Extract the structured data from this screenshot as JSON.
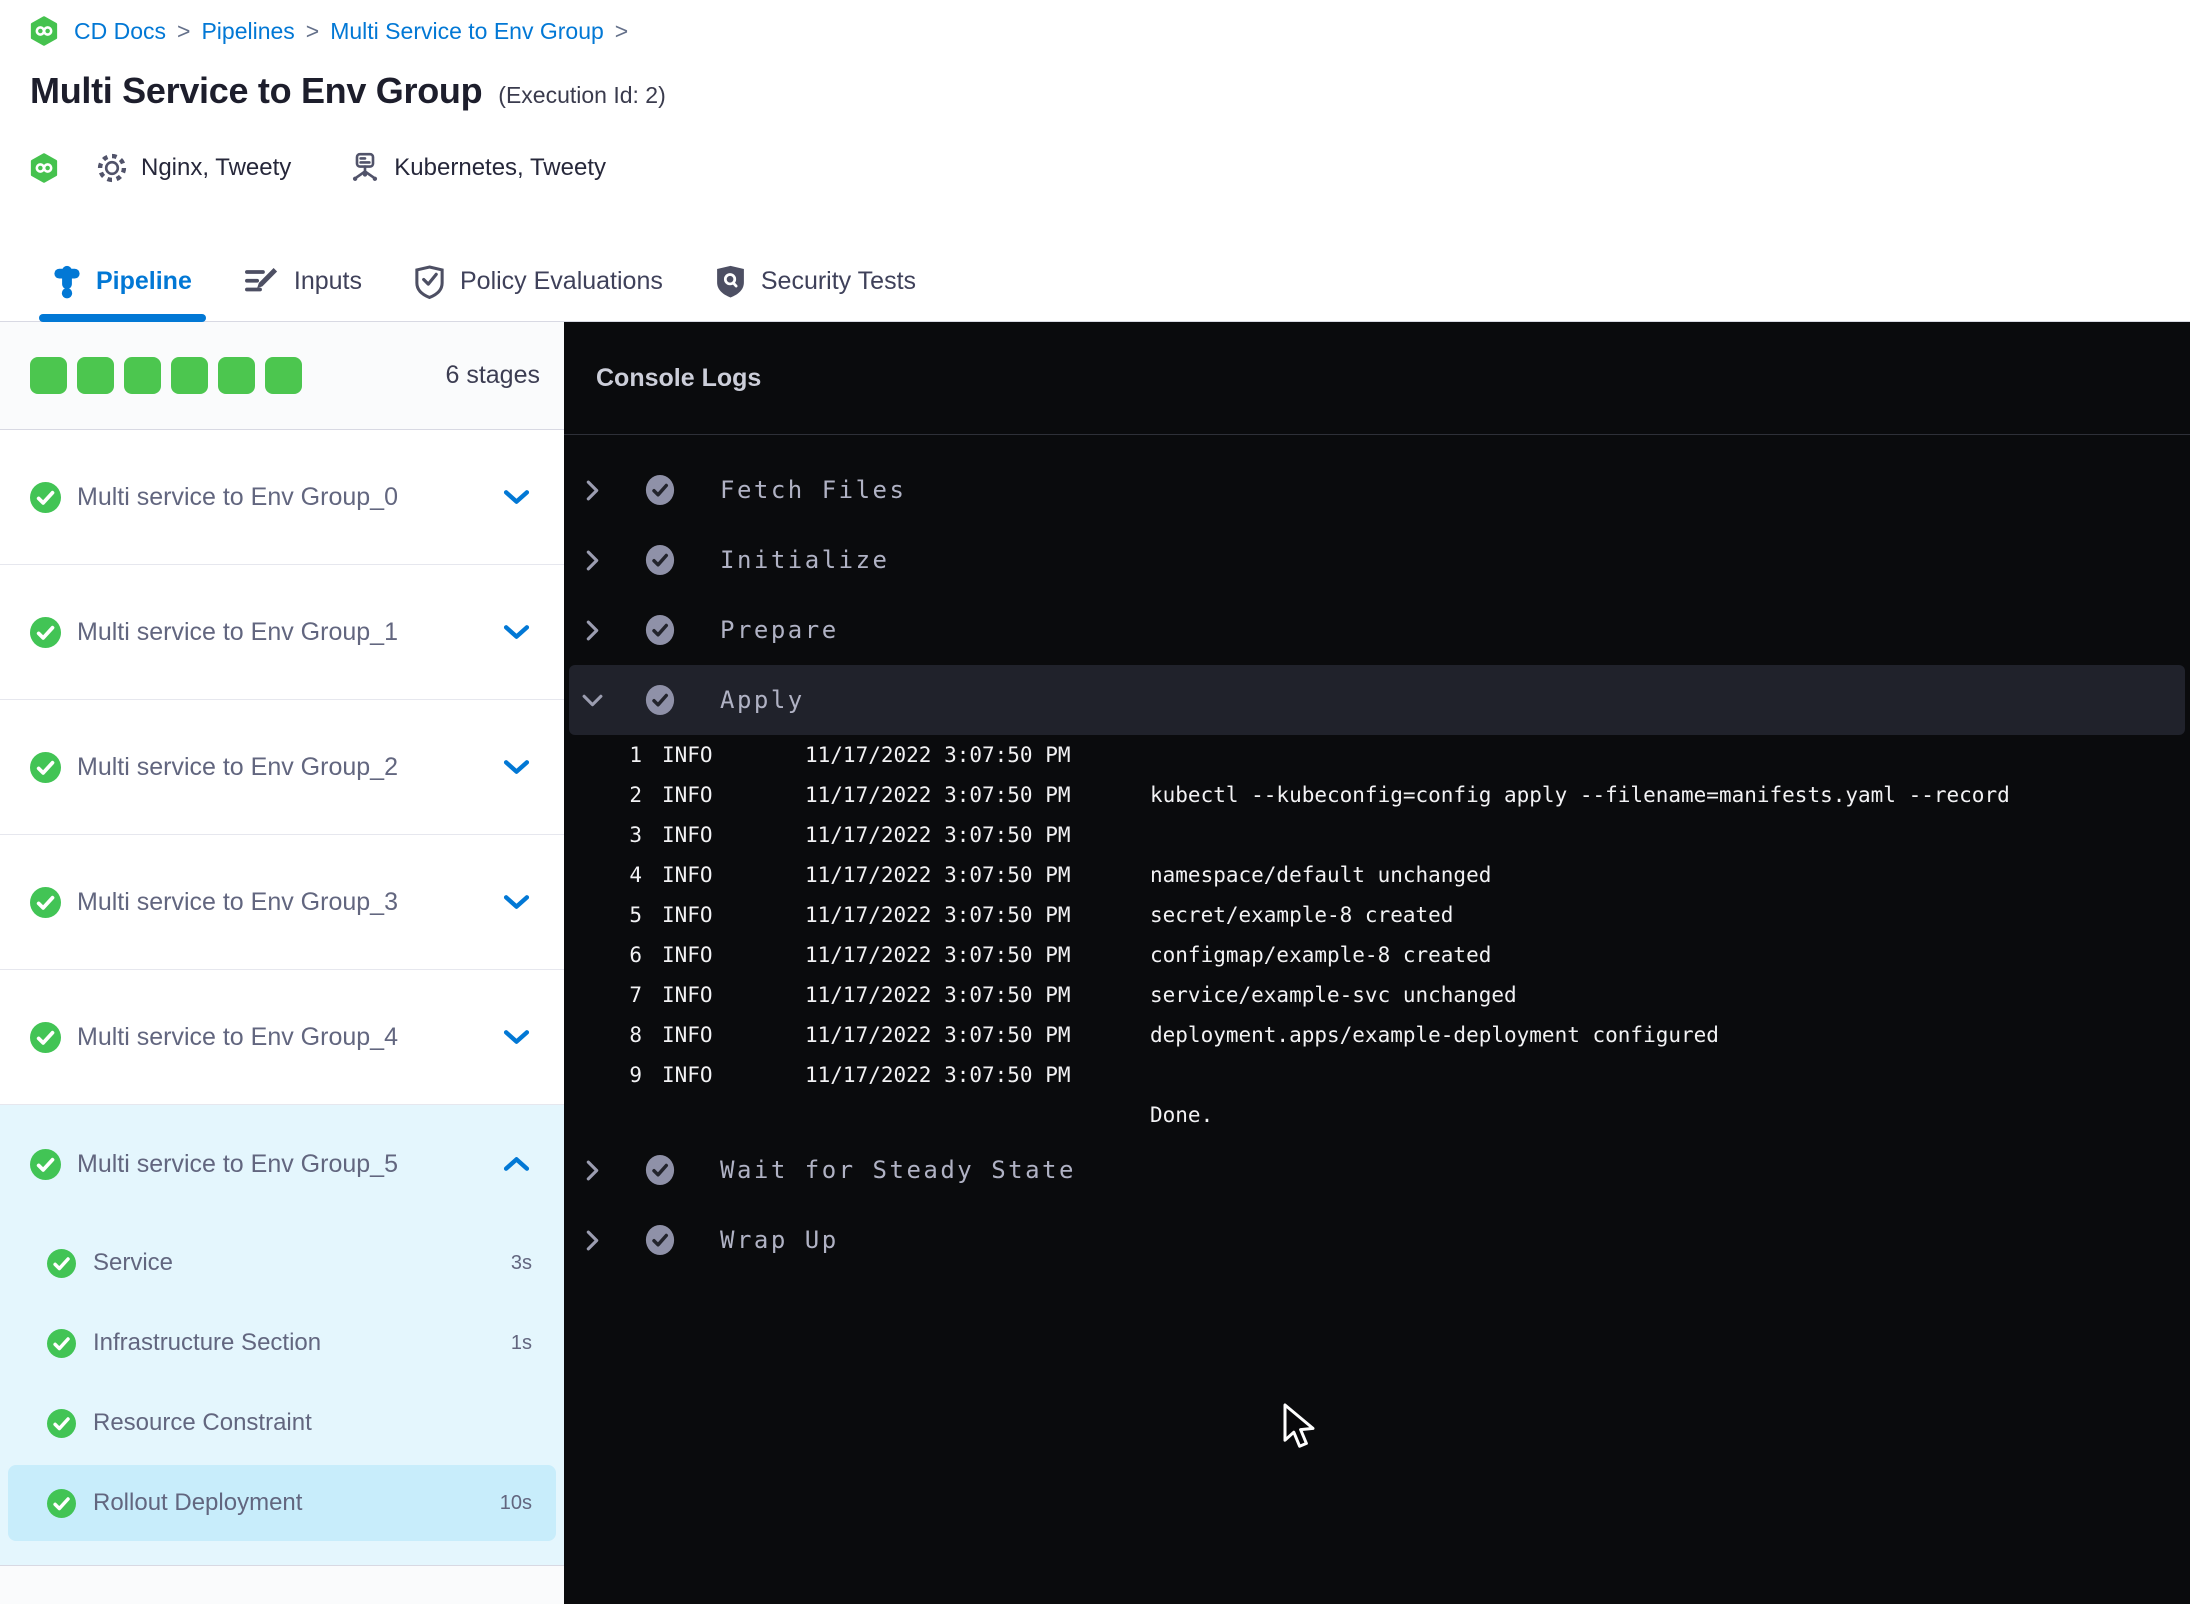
{
  "breadcrumb": {
    "links": [
      "CD Docs",
      "Pipelines",
      "Multi Service to Env Group"
    ],
    "separator": ">"
  },
  "header": {
    "title": "Multi Service to Env Group",
    "execution_id": "(Execution Id: 2)",
    "services_label": "Nginx, Tweety",
    "environments_label": "Kubernetes, Tweety"
  },
  "tabs": [
    {
      "label": "Pipeline",
      "icon": "pipeline-icon",
      "active": true
    },
    {
      "label": "Inputs",
      "icon": "inputs-icon",
      "active": false
    },
    {
      "label": "Policy Evaluations",
      "icon": "policy-shield-icon",
      "active": false
    },
    {
      "label": "Security Tests",
      "icon": "security-shield-icon",
      "active": false
    }
  ],
  "sidebar": {
    "stage_count_label": "6 stages",
    "progress_squares": 6,
    "stages": [
      {
        "label": "Multi service to Env Group_0",
        "status": "success",
        "expanded": false
      },
      {
        "label": "Multi service to Env Group_1",
        "status": "success",
        "expanded": false
      },
      {
        "label": "Multi service to Env Group_2",
        "status": "success",
        "expanded": false
      },
      {
        "label": "Multi service to Env Group_3",
        "status": "success",
        "expanded": false
      },
      {
        "label": "Multi service to Env Group_4",
        "status": "success",
        "expanded": false
      },
      {
        "label": "Multi service to Env Group_5",
        "status": "success",
        "expanded": true,
        "steps": [
          {
            "label": "Service",
            "duration": "3s",
            "selected": false
          },
          {
            "label": "Infrastructure Section",
            "duration": "1s",
            "selected": false
          },
          {
            "label": "Resource Constraint",
            "duration": "",
            "selected": false
          },
          {
            "label": "Rollout Deployment",
            "duration": "10s",
            "selected": true
          }
        ]
      }
    ]
  },
  "console": {
    "title": "Console Logs",
    "sections": [
      {
        "label": "Fetch Files",
        "status": "success",
        "expanded": false
      },
      {
        "label": "Initialize",
        "status": "success",
        "expanded": false
      },
      {
        "label": "Prepare",
        "status": "success",
        "expanded": false
      },
      {
        "label": "Apply",
        "status": "success",
        "expanded": true,
        "logs": [
          {
            "num": "1",
            "level": "INFO",
            "time": "11/17/2022 3:07:50 PM",
            "message": ""
          },
          {
            "num": "2",
            "level": "INFO",
            "time": "11/17/2022 3:07:50 PM",
            "message": "kubectl --kubeconfig=config apply --filename=manifests.yaml --record"
          },
          {
            "num": "3",
            "level": "INFO",
            "time": "11/17/2022 3:07:50 PM",
            "message": ""
          },
          {
            "num": "4",
            "level": "INFO",
            "time": "11/17/2022 3:07:50 PM",
            "message": "namespace/default unchanged"
          },
          {
            "num": "5",
            "level": "INFO",
            "time": "11/17/2022 3:07:50 PM",
            "message": "secret/example-8 created"
          },
          {
            "num": "6",
            "level": "INFO",
            "time": "11/17/2022 3:07:50 PM",
            "message": "configmap/example-8 created"
          },
          {
            "num": "7",
            "level": "INFO",
            "time": "11/17/2022 3:07:50 PM",
            "message": "service/example-svc unchanged"
          },
          {
            "num": "8",
            "level": "INFO",
            "time": "11/17/2022 3:07:50 PM",
            "message": "deployment.apps/example-deployment configured"
          },
          {
            "num": "9",
            "level": "INFO",
            "time": "11/17/2022 3:07:50 PM",
            "message": ""
          },
          {
            "num": "",
            "level": "",
            "time": "",
            "message": "Done."
          }
        ]
      },
      {
        "label": "Wait for Steady State",
        "status": "success",
        "expanded": false
      },
      {
        "label": "Wrap Up",
        "status": "success",
        "expanded": false
      }
    ]
  },
  "colors": {
    "primary_blue": "#0278d5",
    "success_green": "#4cc64f",
    "sidebar_text": "#62667f",
    "expanded_stage_bg": "#e4f6fd",
    "selected_step_bg": "#c8edfb",
    "console_bg": "#0a0b0d",
    "console_text": "#b0b2c4",
    "console_highlight_row": "#20222b",
    "log_text": "#f2f2f4"
  }
}
